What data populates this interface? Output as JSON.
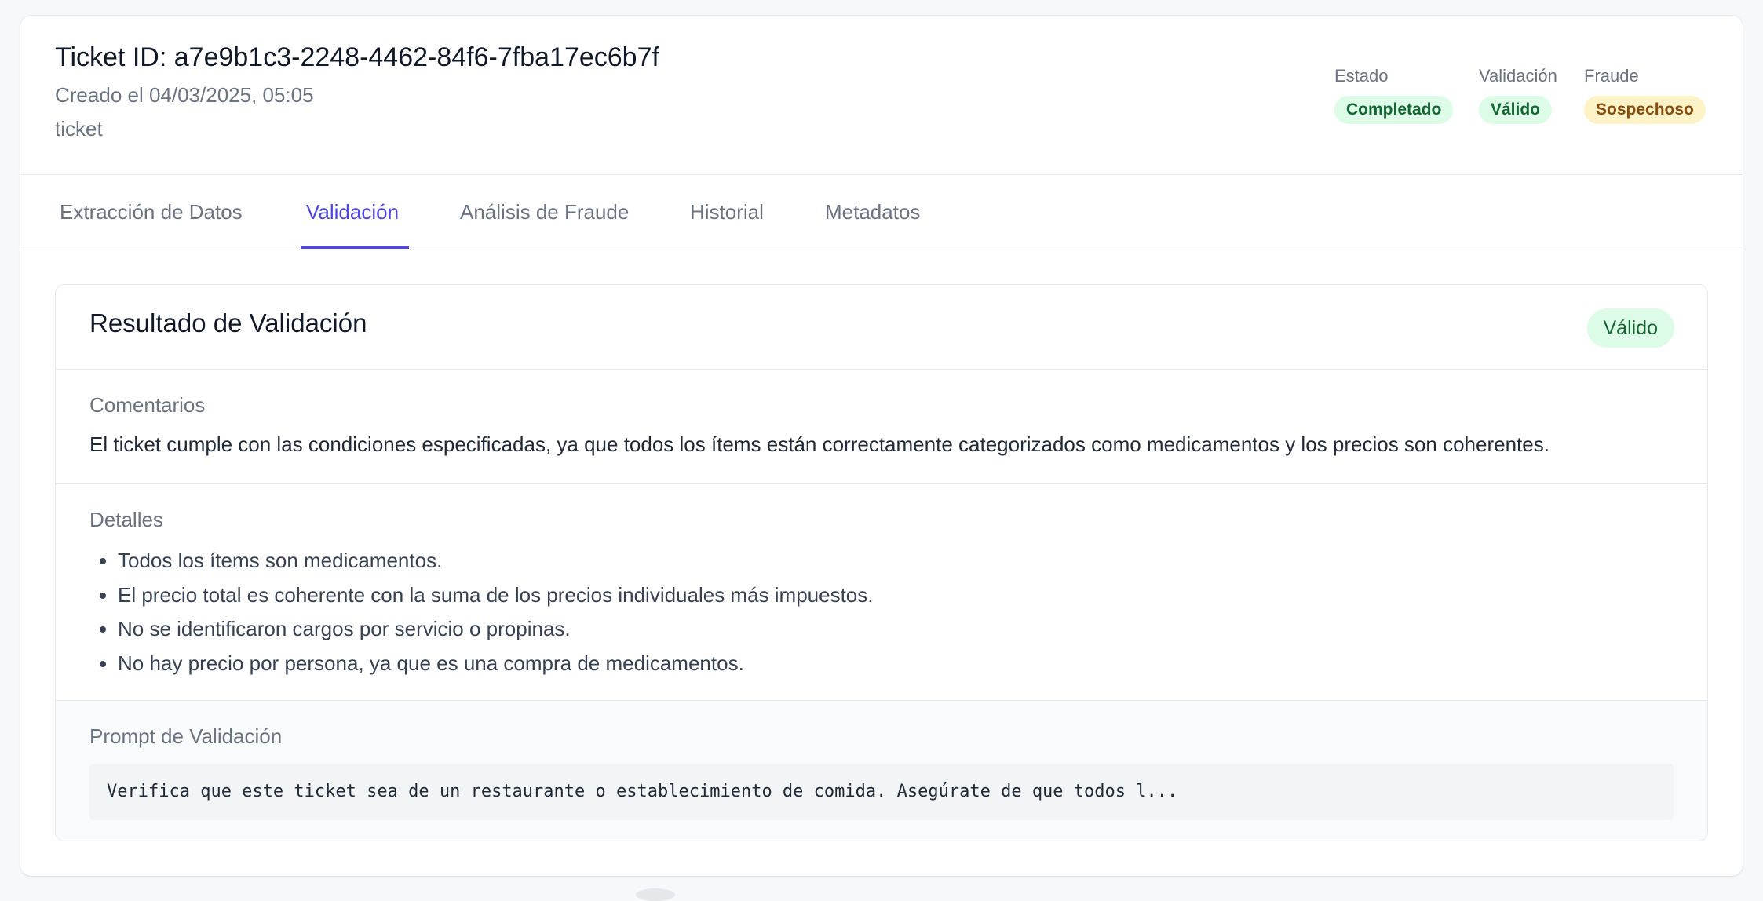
{
  "ticket": {
    "title": "Ticket ID: a7e9b1c3-2248-4462-84f6-7fba17ec6b7f",
    "created": "Creado el 04/03/2025, 05:05",
    "type": "ticket"
  },
  "statuses": [
    {
      "label": "Estado",
      "value": "Completado",
      "tone": "green"
    },
    {
      "label": "Validación",
      "value": "Válido",
      "tone": "green"
    },
    {
      "label": "Fraude",
      "value": "Sospechoso",
      "tone": "yellow"
    }
  ],
  "tabs": [
    {
      "label": "Extracción de Datos",
      "active": false
    },
    {
      "label": "Validación",
      "active": true
    },
    {
      "label": "Análisis de Fraude",
      "active": false
    },
    {
      "label": "Historial",
      "active": false
    },
    {
      "label": "Metadatos",
      "active": false
    }
  ],
  "validation": {
    "title": "Resultado de Validación",
    "badge": "Válido",
    "comments_label": "Comentarios",
    "comments": "El ticket cumple con las condiciones especificadas, ya que todos los ítems están correctamente categorizados como medicamentos y los precios son coherentes.",
    "details_label": "Detalles",
    "details": [
      "Todos los ítems son medicamentos.",
      "El precio total es coherente con la suma de los precios individuales más impuestos.",
      "No se identificaron cargos por servicio o propinas.",
      "No hay precio por persona, ya que es una compra de medicamentos."
    ],
    "prompt_label": "Prompt de Validación",
    "prompt": "Verifica que este ticket sea de un restaurante o establecimiento de comida. Asegúrate de que todos l..."
  },
  "colors": {
    "accent": "#4f46e5",
    "success_bg": "#dcfce7",
    "success_text": "#166534",
    "warning_bg": "#fef3c7",
    "warning_text": "#854d0e"
  }
}
